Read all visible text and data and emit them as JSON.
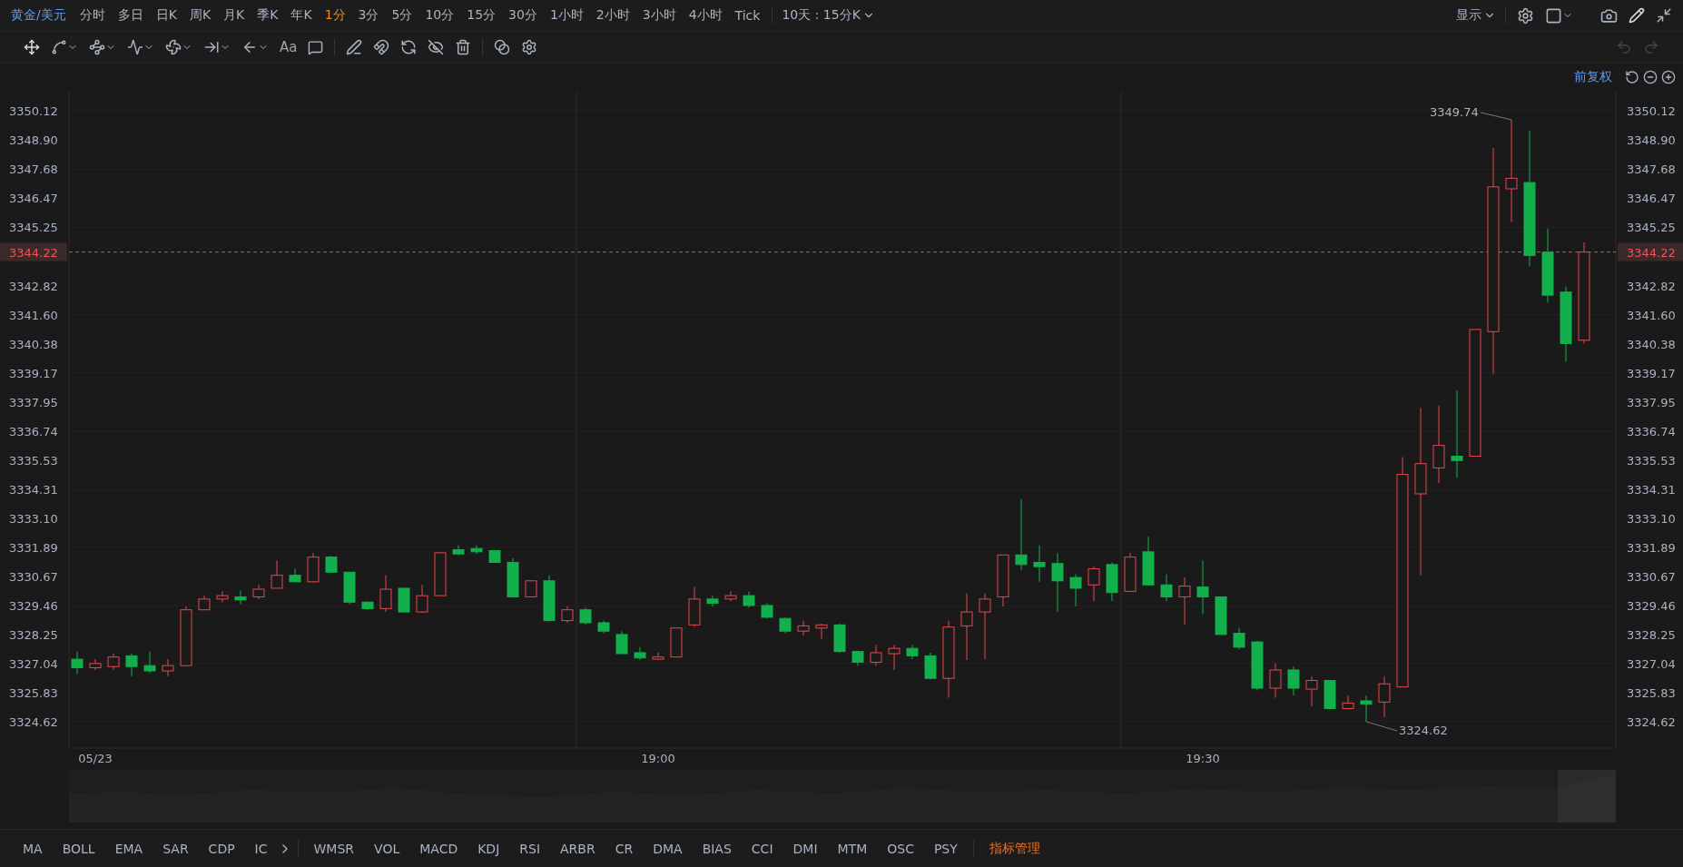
{
  "top_bar": {
    "symbol": "黄金/美元",
    "periods": [
      {
        "label": "分时",
        "selected": false
      },
      {
        "label": "多日",
        "selected": false
      },
      {
        "label": "日K",
        "selected": false
      },
      {
        "label": "周K",
        "selected": false
      },
      {
        "label": "月K",
        "selected": false
      },
      {
        "label": "季K",
        "selected": false
      },
      {
        "label": "年K",
        "selected": false
      },
      {
        "label": "1分",
        "selected": true
      },
      {
        "label": "3分",
        "selected": false
      },
      {
        "label": "5分",
        "selected": false
      },
      {
        "label": "10分",
        "selected": false
      },
      {
        "label": "15分",
        "selected": false
      },
      {
        "label": "30分",
        "selected": false
      },
      {
        "label": "1小时",
        "selected": false
      },
      {
        "label": "2小时",
        "selected": false
      },
      {
        "label": "3小时",
        "selected": false
      },
      {
        "label": "4小时",
        "selected": false
      },
      {
        "label": "Tick",
        "selected": false
      }
    ],
    "range_select": "10天 : 15分K",
    "display_select": "显示"
  },
  "drawing_toolbar": {
    "text_tool": "Aa"
  },
  "chart_header": {
    "adjust_label": "前复权"
  },
  "chart_data": {
    "type": "candlestick",
    "grid": true,
    "ylim": [
      3323.52,
      3350.95
    ],
    "yticks": [
      {
        "value": 3350.12,
        "label": "3350.12"
      },
      {
        "value": 3348.9,
        "label": "3348.90"
      },
      {
        "value": 3347.68,
        "label": "3347.68"
      },
      {
        "value": 3346.47,
        "label": "3346.47"
      },
      {
        "value": 3345.25,
        "label": "3345.25"
      },
      {
        "value": 3342.82,
        "label": "3342.82"
      },
      {
        "value": 3341.6,
        "label": "3341.60"
      },
      {
        "value": 3340.38,
        "label": "3340.38"
      },
      {
        "value": 3339.17,
        "label": "3339.17"
      },
      {
        "value": 3337.95,
        "label": "3337.95"
      },
      {
        "value": 3336.74,
        "label": "3336.74"
      },
      {
        "value": 3335.53,
        "label": "3335.53"
      },
      {
        "value": 3334.31,
        "label": "3334.31"
      },
      {
        "value": 3333.1,
        "label": "3333.10"
      },
      {
        "value": 3331.89,
        "label": "3331.89"
      },
      {
        "value": 3330.67,
        "label": "3330.67"
      },
      {
        "value": 3329.46,
        "label": "3329.46"
      },
      {
        "value": 3328.25,
        "label": "3328.25"
      },
      {
        "value": 3327.04,
        "label": "3327.04"
      },
      {
        "value": 3325.83,
        "label": "3325.83"
      },
      {
        "value": 3324.62,
        "label": "3324.62"
      }
    ],
    "xlim": [
      1107.55,
      1192.75
    ],
    "xticks": [
      {
        "value": 1109,
        "label": "05/23"
      },
      {
        "value": 1140,
        "label": "19:00"
      },
      {
        "value": 1170,
        "label": "19:30"
      }
    ],
    "x": [
      1108,
      1109,
      1110,
      1111,
      1112,
      1113,
      1114,
      1115,
      1116,
      1117,
      1118,
      1119,
      1120,
      1121,
      1122,
      1123,
      1124,
      1125,
      1126,
      1127,
      1128,
      1129,
      1130,
      1131,
      1132,
      1133,
      1134,
      1135,
      1136,
      1137,
      1138,
      1139,
      1140,
      1141,
      1142,
      1143,
      1144,
      1145,
      1146,
      1147,
      1148,
      1149,
      1150,
      1151,
      1152,
      1153,
      1154,
      1155,
      1156,
      1157,
      1158,
      1159,
      1160,
      1161,
      1162,
      1163,
      1164,
      1165,
      1166,
      1167,
      1168,
      1169,
      1170,
      1171,
      1172,
      1173,
      1174,
      1175,
      1176,
      1177,
      1178,
      1179,
      1180,
      1181,
      1182,
      1183,
      1184,
      1185,
      1186,
      1187,
      1188,
      1189,
      1190,
      1191
    ],
    "ohlc": [
      [
        3327.23,
        3327.55,
        3326.61,
        3326.87
      ],
      [
        3326.87,
        3327.23,
        3326.78,
        3327.05
      ],
      [
        3326.92,
        3327.46,
        3326.78,
        3327.32
      ],
      [
        3327.37,
        3327.46,
        3326.52,
        3326.92
      ],
      [
        3326.96,
        3327.55,
        3326.65,
        3326.74
      ],
      [
        3326.74,
        3327.23,
        3326.52,
        3326.96
      ],
      [
        3326.96,
        3329.43,
        3326.96,
        3329.29
      ],
      [
        3329.29,
        3329.88,
        3329.29,
        3329.74
      ],
      [
        3329.74,
        3330.06,
        3329.61,
        3329.88
      ],
      [
        3329.83,
        3330.1,
        3329.52,
        3329.7
      ],
      [
        3329.83,
        3330.33,
        3329.74,
        3330.15
      ],
      [
        3330.19,
        3331.35,
        3330.19,
        3330.73
      ],
      [
        3330.73,
        3331.0,
        3330.46,
        3330.46
      ],
      [
        3330.46,
        3331.67,
        3330.42,
        3331.49
      ],
      [
        3331.49,
        3331.54,
        3330.82,
        3330.86
      ],
      [
        3330.86,
        3330.86,
        3329.52,
        3329.61
      ],
      [
        3329.61,
        3329.65,
        3329.29,
        3329.34
      ],
      [
        3329.34,
        3330.73,
        3329.2,
        3330.15
      ],
      [
        3330.19,
        3330.19,
        3329.2,
        3329.2
      ],
      [
        3329.2,
        3330.33,
        3329.16,
        3329.88
      ],
      [
        3329.88,
        3331.67,
        3329.88,
        3331.67
      ],
      [
        3331.8,
        3331.98,
        3331.58,
        3331.62
      ],
      [
        3331.85,
        3331.98,
        3331.62,
        3331.71
      ],
      [
        3331.76,
        3331.76,
        3331.27,
        3331.27
      ],
      [
        3331.27,
        3331.44,
        3329.83,
        3329.83
      ],
      [
        3329.83,
        3330.5,
        3329.83,
        3330.5
      ],
      [
        3330.5,
        3330.73,
        3328.8,
        3328.84
      ],
      [
        3328.84,
        3329.43,
        3328.75,
        3329.29
      ],
      [
        3329.29,
        3329.38,
        3328.66,
        3328.75
      ],
      [
        3328.75,
        3328.84,
        3328.31,
        3328.4
      ],
      [
        3328.26,
        3328.4,
        3327.46,
        3327.46
      ],
      [
        3327.5,
        3327.73,
        3327.19,
        3327.28
      ],
      [
        3327.23,
        3327.5,
        3327.19,
        3327.32
      ],
      [
        3327.32,
        3328.53,
        3327.32,
        3328.53
      ],
      [
        3328.66,
        3330.24,
        3328.57,
        3329.74
      ],
      [
        3329.74,
        3329.88,
        3329.43,
        3329.56
      ],
      [
        3329.74,
        3330.06,
        3329.65,
        3329.88
      ],
      [
        3329.88,
        3330.06,
        3329.38,
        3329.47
      ],
      [
        3329.47,
        3329.56,
        3328.93,
        3328.98
      ],
      [
        3328.93,
        3328.98,
        3328.31,
        3328.4
      ],
      [
        3328.4,
        3328.84,
        3328.22,
        3328.62
      ],
      [
        3328.53,
        3328.71,
        3328.08,
        3328.66
      ],
      [
        3328.66,
        3328.71,
        3327.5,
        3327.55
      ],
      [
        3327.55,
        3327.59,
        3326.96,
        3327.1
      ],
      [
        3327.1,
        3327.82,
        3326.96,
        3327.5
      ],
      [
        3327.46,
        3327.82,
        3326.78,
        3327.68
      ],
      [
        3327.68,
        3327.82,
        3327.23,
        3327.37
      ],
      [
        3327.37,
        3327.5,
        3326.38,
        3326.43
      ],
      [
        3326.43,
        3328.84,
        3325.62,
        3328.57
      ],
      [
        3328.62,
        3329.97,
        3327.19,
        3329.2
      ],
      [
        3329.2,
        3329.97,
        3327.23,
        3329.74
      ],
      [
        3329.83,
        3331.58,
        3329.43,
        3331.58
      ],
      [
        3331.58,
        3333.91,
        3330.95,
        3331.18
      ],
      [
        3331.27,
        3331.98,
        3330.46,
        3331.09
      ],
      [
        3331.22,
        3331.67,
        3329.2,
        3330.5
      ],
      [
        3330.64,
        3330.77,
        3329.43,
        3330.19
      ],
      [
        3330.33,
        3331.09,
        3329.65,
        3331.0
      ],
      [
        3331.18,
        3331.27,
        3329.65,
        3330.01
      ],
      [
        3330.06,
        3331.67,
        3330.06,
        3331.49
      ],
      [
        3331.71,
        3332.34,
        3330.33,
        3330.33
      ],
      [
        3330.33,
        3330.77,
        3329.65,
        3329.83
      ],
      [
        3329.83,
        3330.64,
        3328.66,
        3330.28
      ],
      [
        3330.24,
        3331.35,
        3329.11,
        3329.83
      ],
      [
        3329.83,
        3329.83,
        3328.26,
        3328.26
      ],
      [
        3328.31,
        3328.53,
        3327.64,
        3327.73
      ],
      [
        3327.95,
        3327.99,
        3325.93,
        3326.02
      ],
      [
        3326.02,
        3327.05,
        3325.62,
        3326.78
      ],
      [
        3326.78,
        3326.92,
        3325.71,
        3326.02
      ],
      [
        3325.98,
        3326.52,
        3325.26,
        3326.34
      ],
      [
        3326.34,
        3326.34,
        3325.13,
        3325.17
      ],
      [
        3325.17,
        3325.71,
        3325.13,
        3325.4
      ],
      [
        3325.49,
        3325.71,
        3324.62,
        3325.35
      ],
      [
        3325.44,
        3326.52,
        3324.81,
        3326.2
      ],
      [
        3326.07,
        3335.66,
        3326.07,
        3334.94
      ],
      [
        3334.13,
        3337.72,
        3330.73,
        3335.39
      ],
      [
        3335.21,
        3337.81,
        3334.58,
        3336.15
      ],
      [
        3335.7,
        3338.44,
        3334.8,
        3335.52
      ],
      [
        3335.7,
        3340.99,
        3335.7,
        3340.99
      ],
      [
        3340.9,
        3348.56,
        3339.15,
        3346.94
      ],
      [
        3346.86,
        3349.74,
        3345.47,
        3347.3
      ],
      [
        3347.12,
        3349.27,
        3343.63,
        3344.08
      ],
      [
        3344.21,
        3345.2,
        3342.11,
        3342.42
      ],
      [
        3342.55,
        3342.78,
        3339.64,
        3340.4
      ],
      [
        3340.54,
        3344.62,
        3340.4,
        3344.22
      ]
    ],
    "annotations": [
      "3349.74",
      "3324.62"
    ],
    "ref_lines": [
      {
        "axis": "x",
        "value": 1135.5
      },
      {
        "axis": "x",
        "value": 1165.5
      },
      {
        "axis": "y",
        "value": 3344.22
      }
    ]
  },
  "last_price": {
    "left_tag": "3344.22",
    "right_tag": "3344.22"
  },
  "right_axis": {
    "labels": [
      "3350.12",
      "3348.90",
      "3347.68",
      "3346.47",
      "3345.25",
      "3342.82",
      "3341.60",
      "3340.38",
      "3339.17",
      "3337.95",
      "3336.74",
      "3335.53",
      "3334.31",
      "3333.10",
      "3331.89",
      "3330.67",
      "3329.46",
      "3328.25",
      "3327.04",
      "3325.83",
      "3324.62"
    ]
  },
  "indicator_bar": {
    "items": [
      "MA",
      "BOLL",
      "EMA",
      "SAR",
      "CDP",
      "IC"
    ],
    "more_items": [
      "WMSR",
      "VOL",
      "MACD",
      "KDJ",
      "RSI",
      "ARBR",
      "CR",
      "DMA",
      "BIAS",
      "CCI",
      "DMI",
      "MTM",
      "OSC",
      "PSY"
    ],
    "manage": "指标管理"
  }
}
